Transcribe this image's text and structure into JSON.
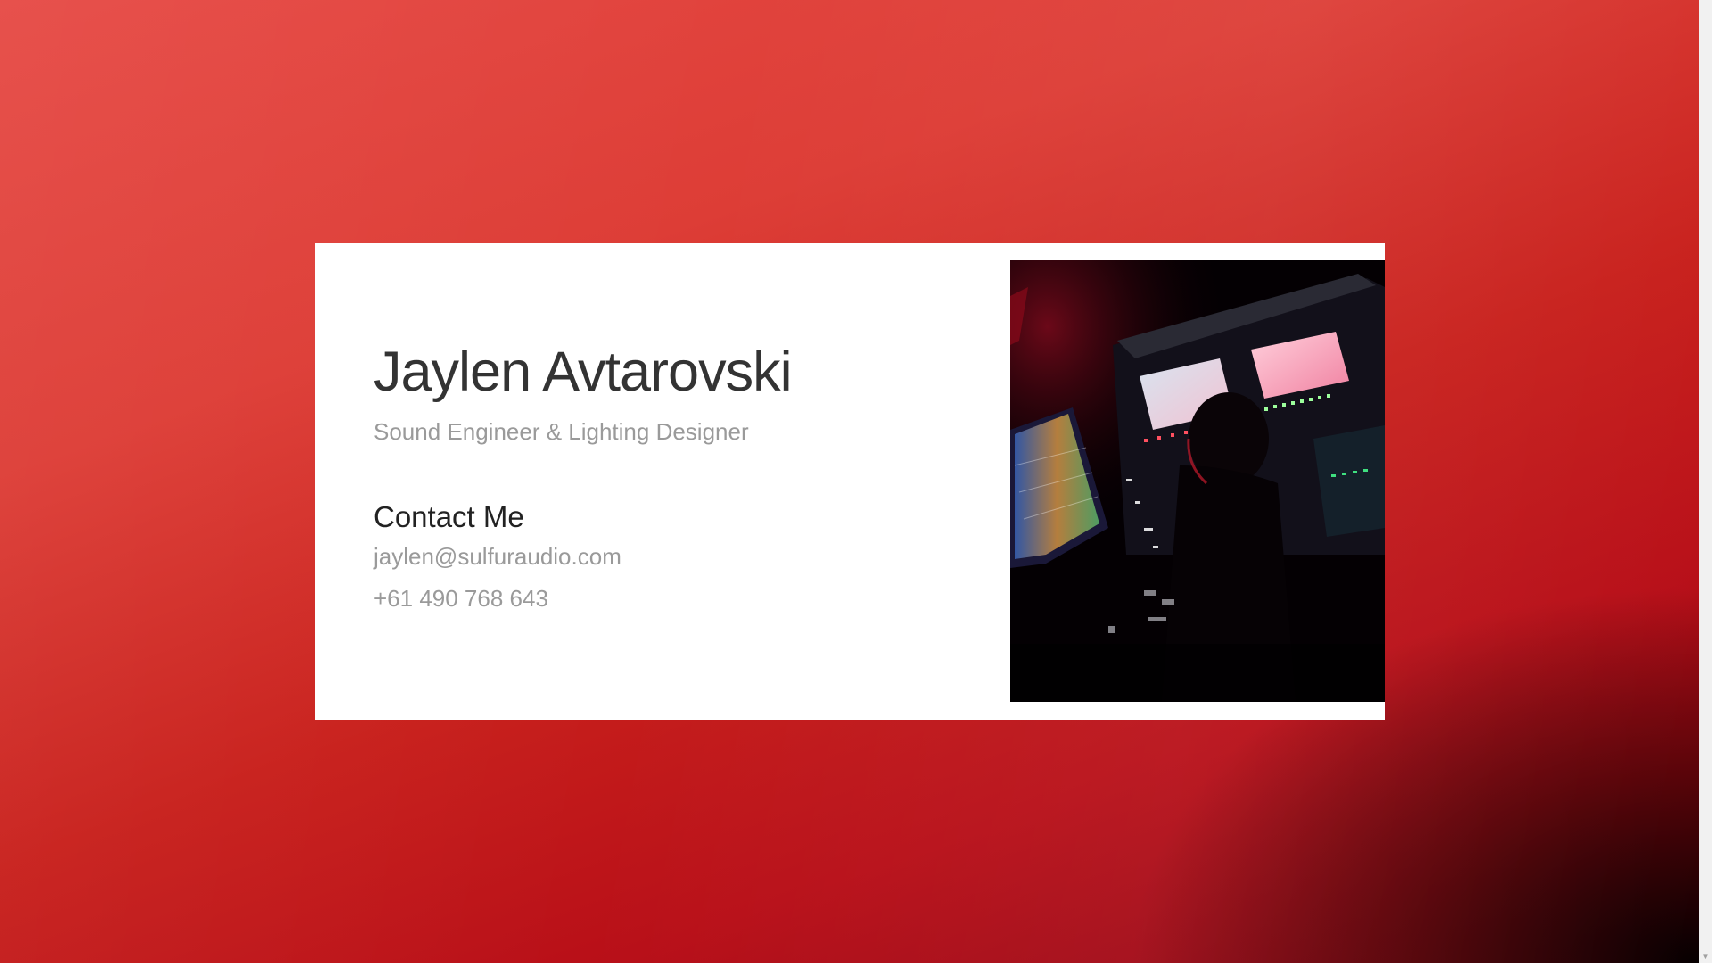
{
  "card": {
    "name": "Jaylen Avtarovski",
    "subtitle": "Sound Engineer & Lighting Designer",
    "contact_heading": "Contact Me",
    "email": "jaylen@sulfuraudio.com",
    "phone": "+61 490 768 643"
  },
  "photo": {
    "subject": "sound engineer at mixing console"
  },
  "colors": {
    "background_top": "#e64a45",
    "background_bottom": "#b80f18",
    "card": "#ffffff",
    "name_text": "#333333",
    "muted_text": "#9a9a9a"
  }
}
